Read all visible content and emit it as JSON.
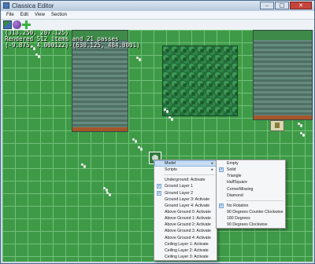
{
  "window": {
    "title": "Classica Editor",
    "buttons": {
      "minimize": "–",
      "maximize": "□",
      "close": "✕"
    }
  },
  "menubar": [
    "File",
    "Edit",
    "View",
    "Section"
  ],
  "toolbar": {
    "icons": [
      "map-icon",
      "globe-icon",
      "add-icon"
    ]
  },
  "overlay": {
    "line1": "(313.250, 207.125)",
    "line2": "Rendered 512 items and 21 passes",
    "line3": "(-9.875, 4.000122)-(630.125, 484.0001)"
  },
  "context_menu": {
    "items": [
      {
        "label": "Model",
        "submenu": true,
        "highlighted": true,
        "checked": false
      },
      {
        "label": "Scripts",
        "submenu": true,
        "highlighted": false,
        "checked": false
      },
      {
        "separator": true
      },
      {
        "label": "Underground: Activate",
        "checked": false
      },
      {
        "label": "Ground Layer 1",
        "checked": true
      },
      {
        "label": "Ground Layer 2",
        "checked": true
      },
      {
        "label": "Ground Layer 3: Activate",
        "checked": false
      },
      {
        "label": "Ground Layer 4: Activate",
        "checked": false
      },
      {
        "label": "Above Ground 0: Activate",
        "checked": false
      },
      {
        "label": "Above Ground 1: Activate",
        "checked": false
      },
      {
        "label": "Above Ground 2: Activate",
        "checked": false
      },
      {
        "label": "Above Ground 3: Activate",
        "checked": false
      },
      {
        "label": "Above Ground 4: Activate",
        "checked": false
      },
      {
        "label": "Ceiling Layer 1: Activate",
        "checked": false
      },
      {
        "label": "Ceiling Layer 2: Activate",
        "checked": false
      },
      {
        "label": "Ceiling Layer 3: Activate",
        "checked": false
      }
    ]
  },
  "model_submenu": {
    "shape_items": [
      {
        "label": "Empty",
        "checked": false
      },
      {
        "label": "Solid",
        "checked": true
      },
      {
        "label": "Triangle",
        "checked": false
      },
      {
        "label": "HalfSquare",
        "checked": false
      },
      {
        "label": "CornerMissing",
        "checked": false
      },
      {
        "label": "Diamond",
        "checked": false
      }
    ],
    "rotation_items": [
      {
        "label": "No Rotation",
        "checked": true
      },
      {
        "label": "90 Degrees Counter Clockwise",
        "checked": false
      },
      {
        "label": "180 Degrees",
        "checked": false
      },
      {
        "label": "90 Degrees Clockwise",
        "checked": false
      }
    ]
  }
}
